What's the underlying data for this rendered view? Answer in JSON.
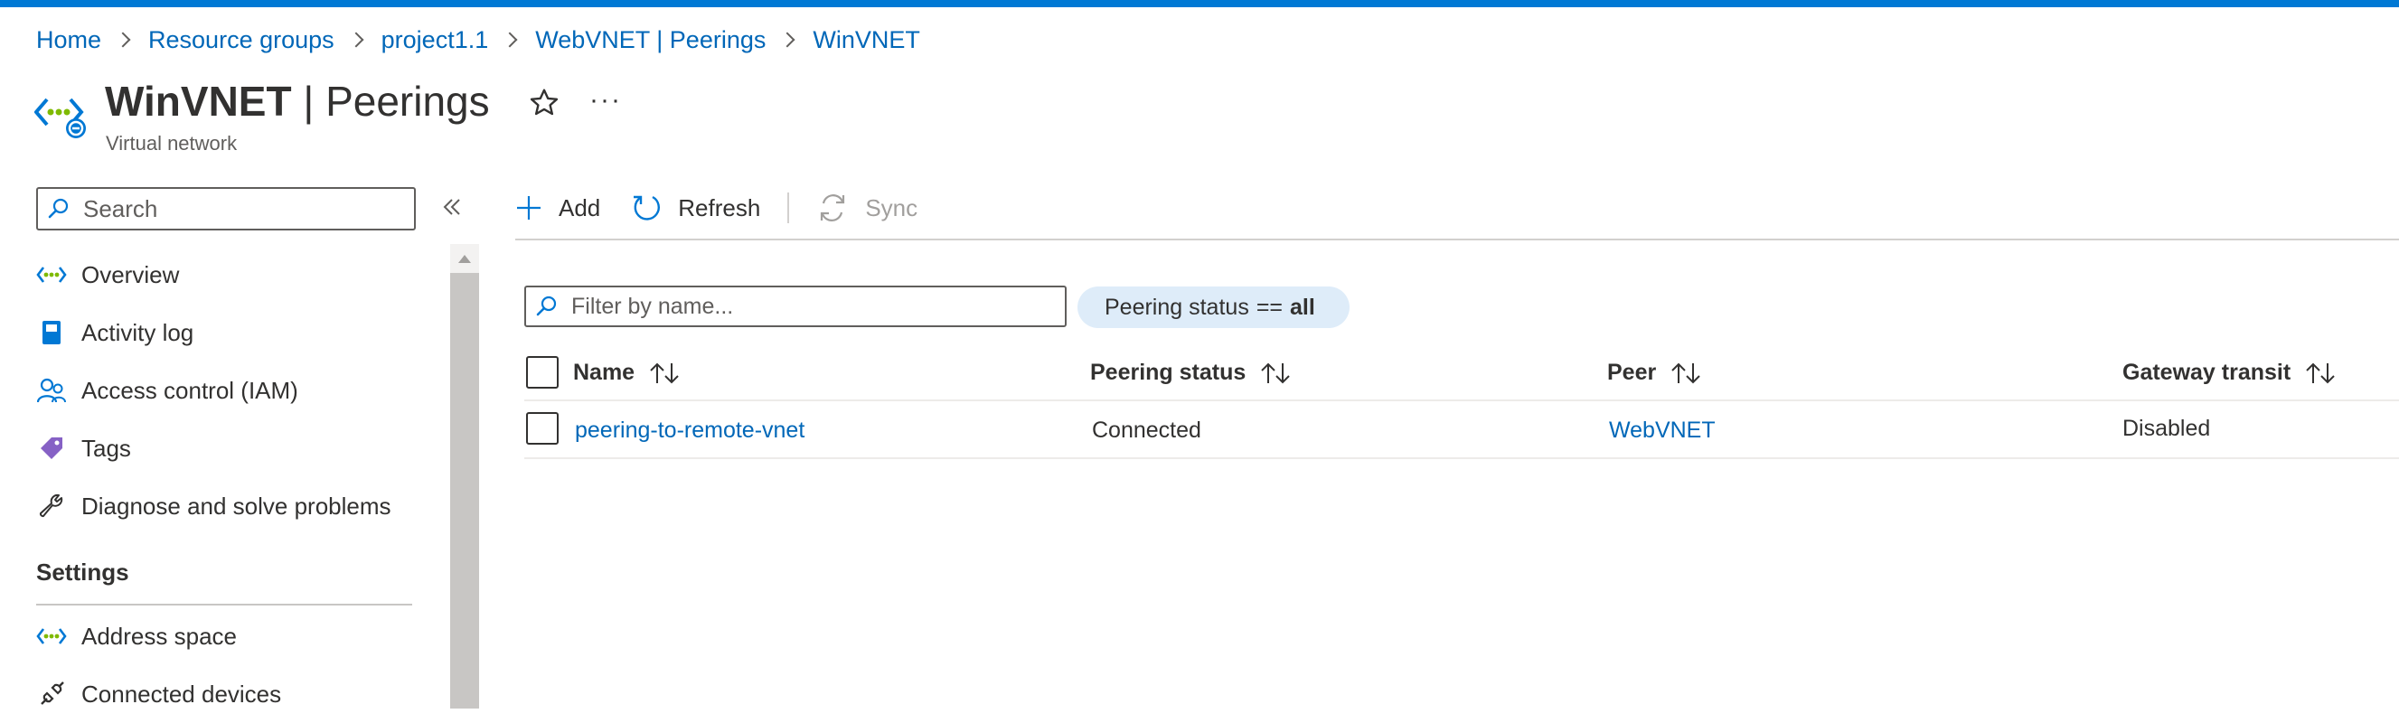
{
  "breadcrumb": [
    "Home",
    "Resource groups",
    "project1.1",
    "WebVNET | Peerings",
    "WinVNET"
  ],
  "header": {
    "title_bold": "WinVNET",
    "title_rest": " | Peerings",
    "subtitle": "Virtual network",
    "favorite_icon": "star-icon",
    "more_label": "···"
  },
  "nav": {
    "search_placeholder": "Search",
    "items": [
      {
        "label": "Overview",
        "icon": "vnet-icon"
      },
      {
        "label": "Activity log",
        "icon": "book-icon"
      },
      {
        "label": "Access control (IAM)",
        "icon": "people-icon"
      },
      {
        "label": "Tags",
        "icon": "tag-icon"
      },
      {
        "label": "Diagnose and solve problems",
        "icon": "wrench-icon"
      }
    ],
    "section": "Settings",
    "settings_items": [
      {
        "label": "Address space",
        "icon": "vnet-icon"
      },
      {
        "label": "Connected devices",
        "icon": "plug-icon"
      }
    ]
  },
  "commands": {
    "add": "Add",
    "refresh": "Refresh",
    "sync": "Sync"
  },
  "filter": {
    "placeholder": "Filter by name...",
    "pill_field": "Peering status",
    "pill_op": "==",
    "pill_value": "all"
  },
  "table": {
    "columns": [
      "Name",
      "Peering status",
      "Peer",
      "Gateway transit"
    ],
    "rows": [
      {
        "name": "peering-to-remote-vnet",
        "status": "Connected",
        "peer": "WebVNET",
        "gateway": "Disabled"
      }
    ]
  },
  "colors": {
    "accent": "#0078d4",
    "link": "#0067b8",
    "pill_bg": "#deecf9"
  }
}
